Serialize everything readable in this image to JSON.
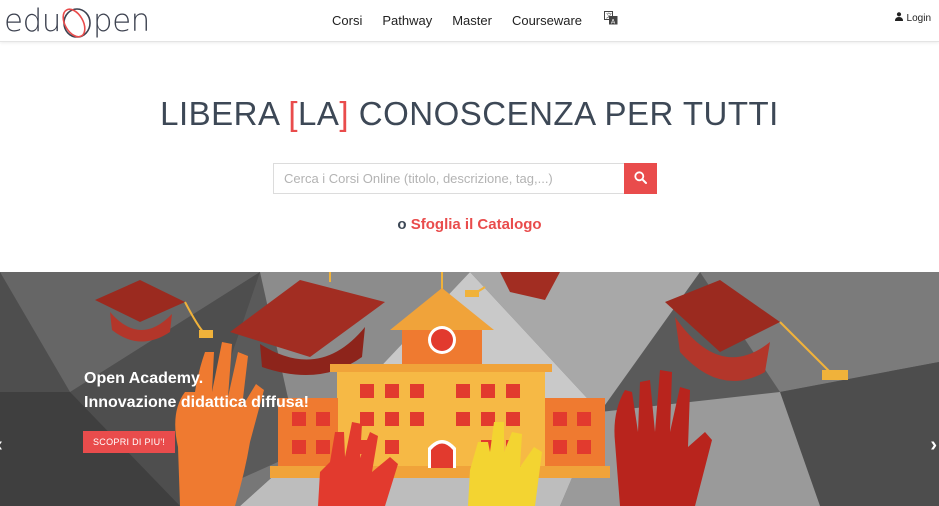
{
  "brand": {
    "logo_text_left": "edu",
    "logo_text_right": "pen",
    "accent_color": "#e94c4c"
  },
  "nav": {
    "items": [
      {
        "label": "Corsi"
      },
      {
        "label": "Pathway"
      },
      {
        "label": "Master"
      },
      {
        "label": "Courseware"
      }
    ],
    "language_icon": "translate-icon",
    "login_label": "Login",
    "login_icon": "user-icon"
  },
  "hero": {
    "title_before": "LIBERA ",
    "title_bracket_open": "[",
    "title_highlight": "LA",
    "title_bracket_close": "]",
    "title_after": " CONOSCENZA PER TUTTI"
  },
  "search": {
    "placeholder": "Cerca i Corsi Online (titolo, descrizione, tag,...)",
    "value": "",
    "button_icon": "search-icon"
  },
  "browse": {
    "prefix": "o ",
    "link_label": "Sfoglia il Catalogo"
  },
  "banner": {
    "line1": "Open Academy.",
    "line2": "Innovazione didattica diffusa!",
    "button_label": "SCOPRI DI PIU'!",
    "prev_icon": "chevron-left-icon",
    "next_icon": "chevron-right-icon"
  }
}
